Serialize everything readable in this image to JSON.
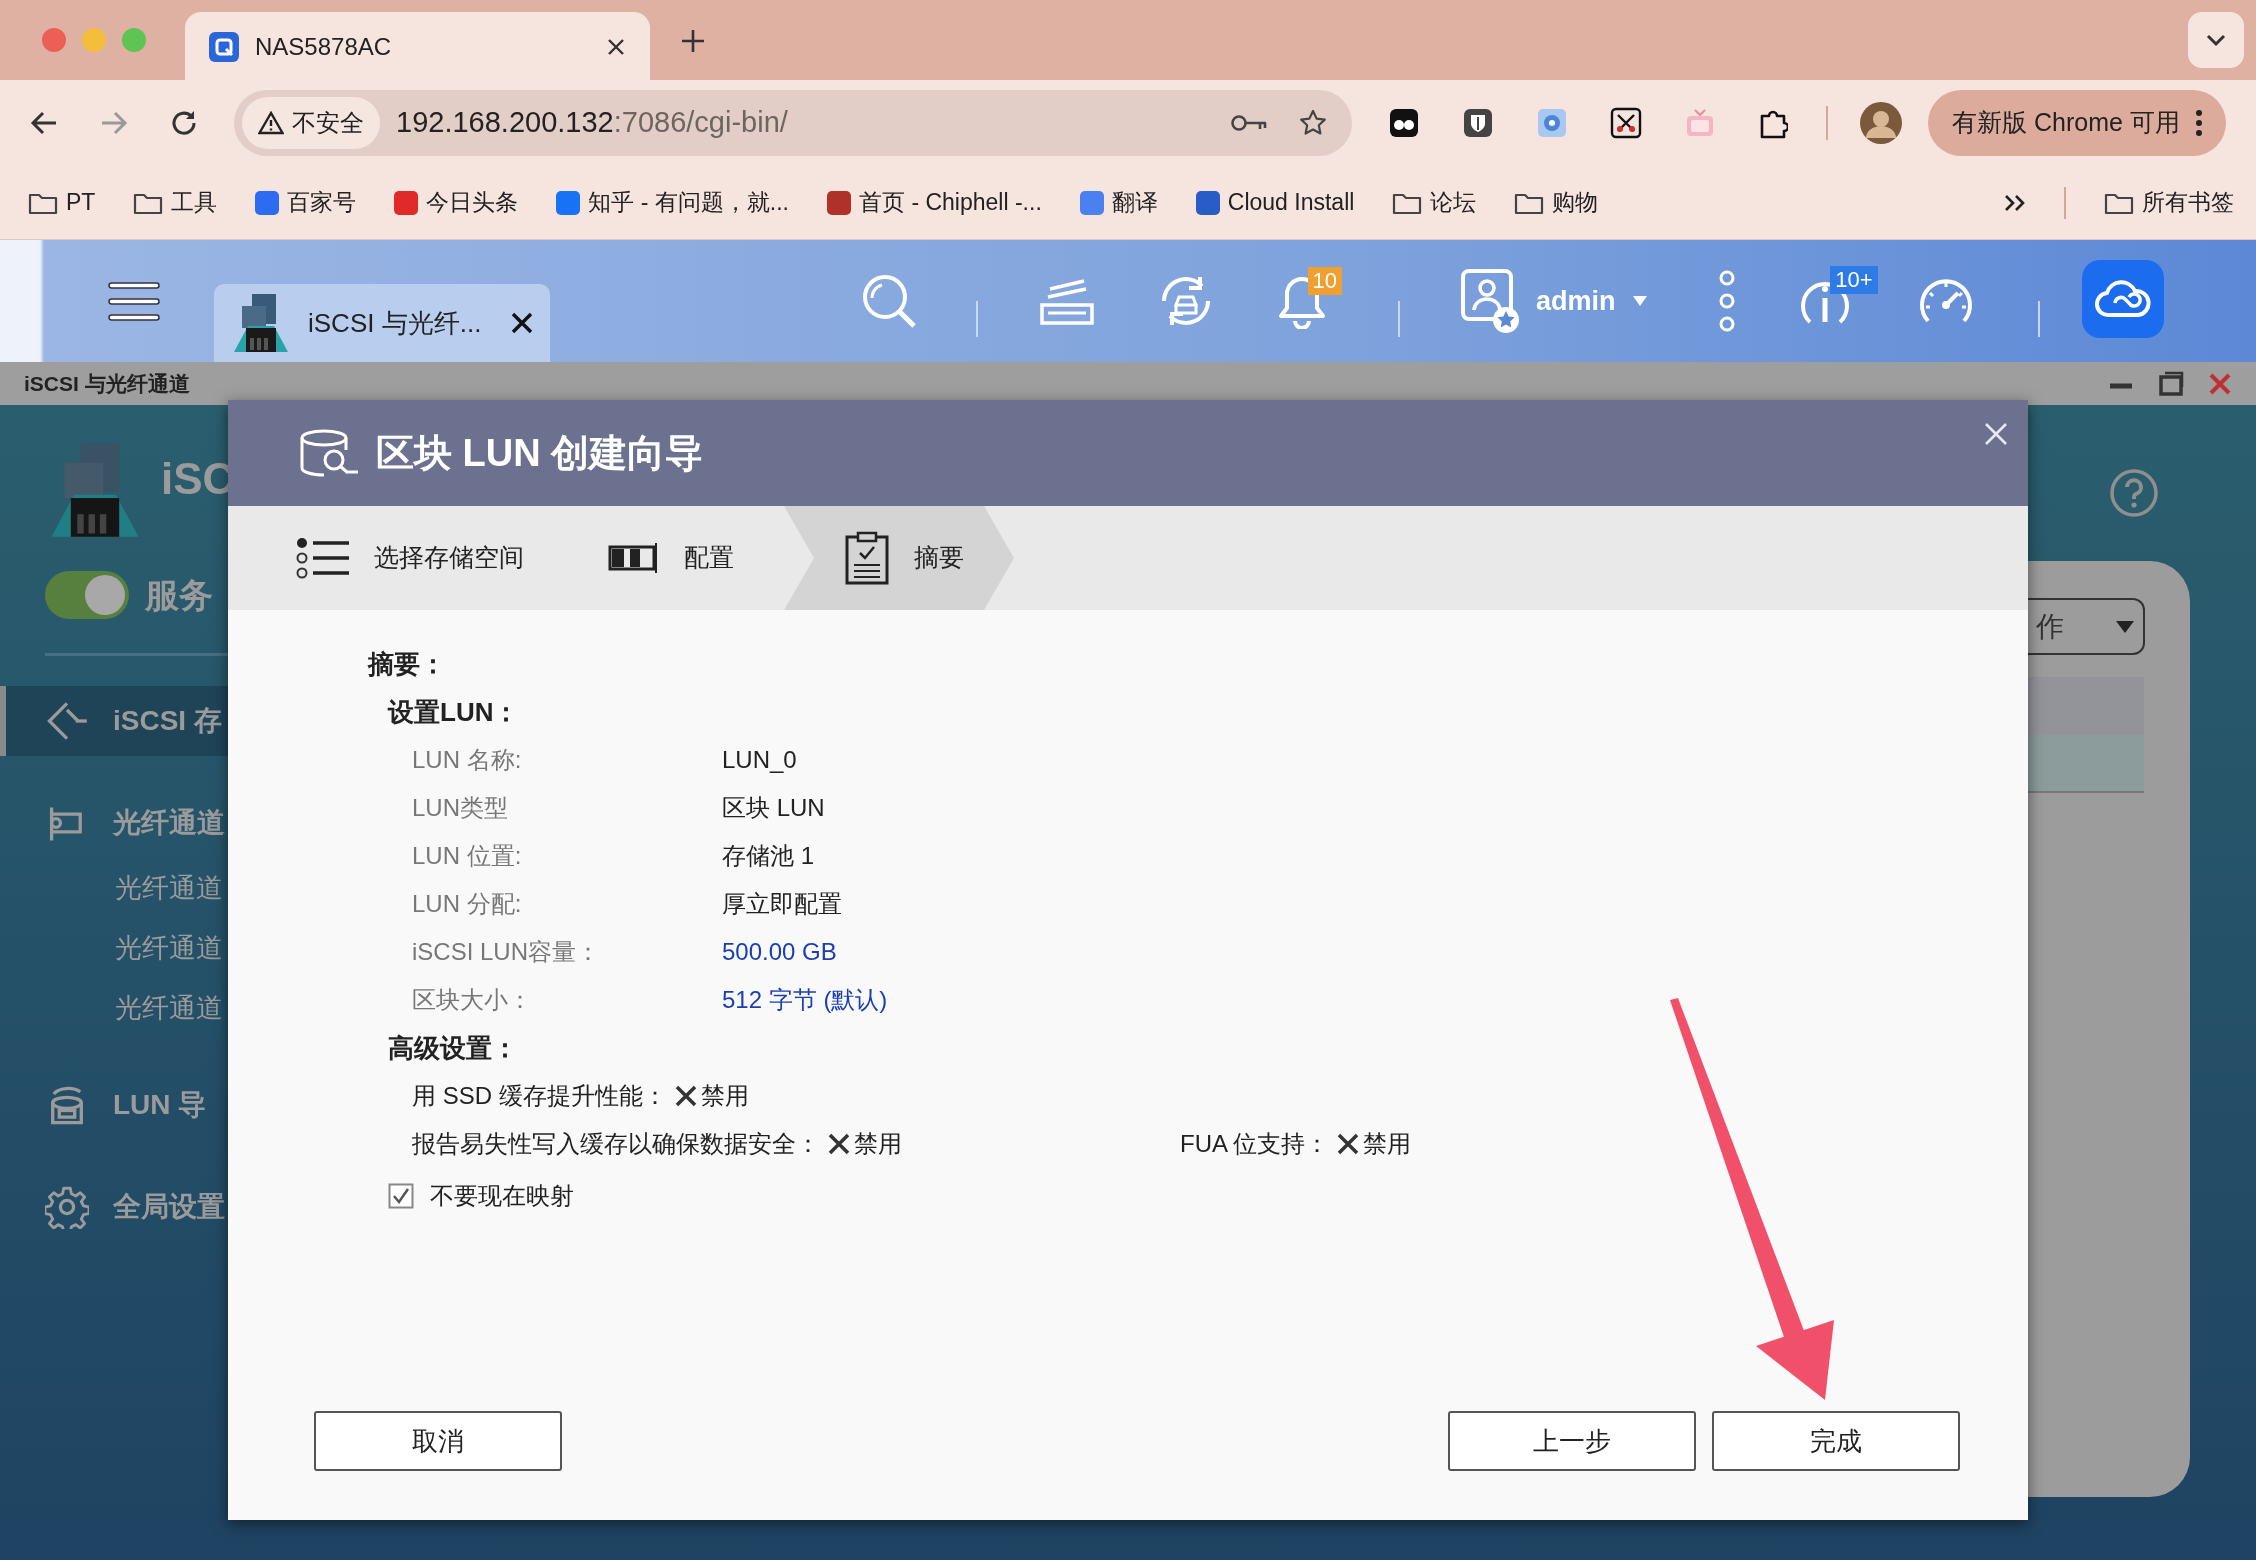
{
  "browser": {
    "tabs": [
      {
        "title": "NAS5878AC",
        "selected": true
      }
    ],
    "address": {
      "security": "不安全",
      "host": "192.168.200.132",
      "path": ":7086/cgi-bin/"
    },
    "update_button": "有新版 Chrome 可用",
    "bookmarks": [
      {
        "label": "PT",
        "kind": "folder"
      },
      {
        "label": "工具",
        "kind": "folder"
      },
      {
        "label": "百家号",
        "kind": "site",
        "color": "#2d6bf0"
      },
      {
        "label": "今日头条",
        "kind": "site",
        "color": "#e02a2a"
      },
      {
        "label": "知乎 - 有问题，就...",
        "kind": "site",
        "color": "#1772f6"
      },
      {
        "label": "首页 - Chiphell -...",
        "kind": "site",
        "color": "#b0302a"
      },
      {
        "label": "翻译",
        "kind": "site",
        "color": "#4a80f0"
      },
      {
        "label": "Cloud Install",
        "kind": "site",
        "color": "#2a5cc8"
      },
      {
        "label": "论坛",
        "kind": "folder"
      },
      {
        "label": "购物",
        "kind": "folder"
      }
    ],
    "all_bookmarks": "所有书签"
  },
  "nas": {
    "app_tab": "iSCSI 与光纤...",
    "notification_count": "10",
    "user": "admin",
    "info_count": "10+"
  },
  "window": {
    "title": "iSCSI 与光纤通道"
  },
  "sidebar": {
    "app_title": "iSC",
    "service": {
      "label": "服务",
      "on": true
    },
    "items": [
      {
        "label": "iSCSI 存",
        "kind": "iscsi",
        "selected": true
      },
      {
        "label": "光纤通道",
        "kind": "fibre",
        "selected": false
      },
      {
        "label": "光纤通道",
        "kind": "sub",
        "selected": false
      },
      {
        "label": "光纤通道",
        "kind": "sub",
        "selected": false
      },
      {
        "label": "光纤通道",
        "kind": "sub",
        "selected": false
      },
      {
        "label": "LUN 导",
        "kind": "import",
        "selected": false
      },
      {
        "label": "全局设置",
        "kind": "settings",
        "selected": false
      }
    ]
  },
  "right_panel": {
    "dropdown": "作"
  },
  "dialog": {
    "title": "区块 LUN 创建向导",
    "steps": [
      {
        "label": "选择存储空间",
        "kind": "list",
        "selected": false
      },
      {
        "label": "配置",
        "kind": "config",
        "selected": false
      },
      {
        "label": "摘要",
        "kind": "summary",
        "selected": true
      }
    ],
    "heading": "摘要：",
    "section": "设置LUN：",
    "rows": [
      {
        "label": "LUN 名称:",
        "value": "LUN_0",
        "accent": false
      },
      {
        "label": "LUN类型",
        "value": "区块 LUN",
        "accent": false
      },
      {
        "label": "LUN 位置:",
        "value": "存储池 1",
        "accent": false
      },
      {
        "label": "LUN 分配:",
        "value": "厚立即配置",
        "accent": false
      },
      {
        "label": "iSCSI LUN容量：",
        "value": "500.00 GB",
        "accent": true
      },
      {
        "label": "区块大小：",
        "value": "512 字节 (默认)",
        "accent": true
      }
    ],
    "advanced_heading": "高级设置：",
    "advanced_rows": [
      {
        "options": [
          {
            "label": "用 SSD 缓存提升性能：",
            "value": "禁用",
            "enabled": false
          }
        ]
      },
      {
        "options": [
          {
            "label": "报告易失性写入缓存以确保数据安全：",
            "value": "禁用",
            "enabled": false
          },
          {
            "label": "FUA 位支持：",
            "value": "禁用",
            "enabled": false
          }
        ]
      }
    ],
    "checkbox": {
      "label": "不要现在映射",
      "checked": true
    },
    "buttons": {
      "cancel": "取消",
      "back": "上一步",
      "finish": "完成"
    }
  }
}
